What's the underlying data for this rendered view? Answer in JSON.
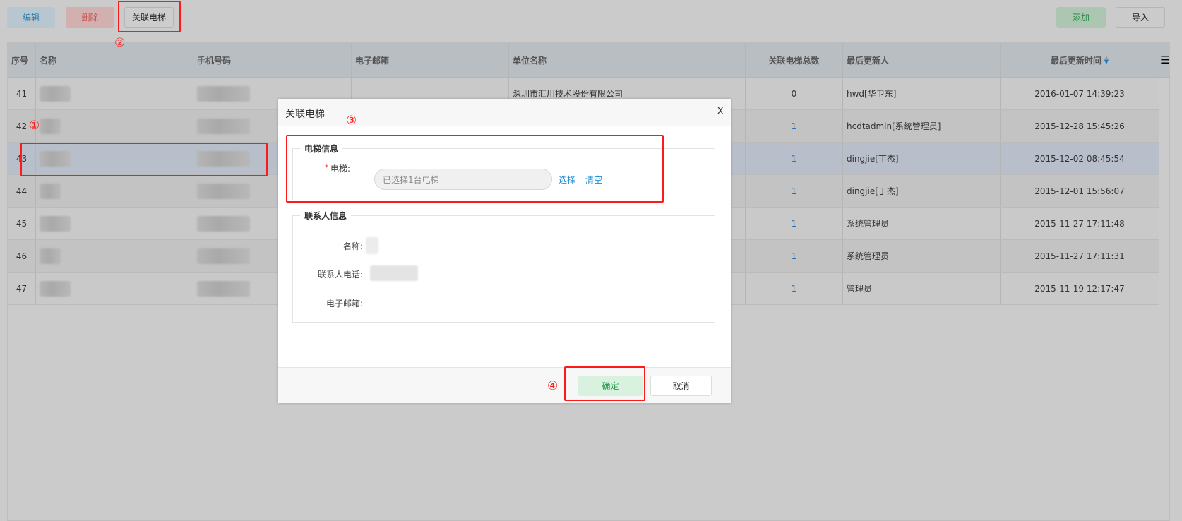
{
  "toolbar": {
    "edit": "编辑",
    "delete": "删除",
    "link_elevator": "关联电梯",
    "add": "添加",
    "import": "导入"
  },
  "annotations": [
    "①",
    "②",
    "③",
    "④"
  ],
  "table": {
    "columns": [
      "序号",
      "名称",
      "手机号码",
      "电子邮箱",
      "单位名称",
      "关联电梯总数",
      "最后更新人",
      "最后更新时间"
    ],
    "sort_icon": "sort-icon",
    "menu_icon": "hamburger-menu-icon",
    "rows": [
      {
        "no": "41",
        "company": "深圳市汇川技术股份有限公司",
        "count": "0",
        "updater": "hwd[华卫东]",
        "time": "2016-01-07 14:39:23"
      },
      {
        "no": "42",
        "company": "",
        "count": "1",
        "updater": "hcdtadmin[系统管理员]",
        "time": "2015-12-28 15:45:26"
      },
      {
        "no": "43",
        "company": "",
        "count": "1",
        "updater": "dingjie[丁杰]",
        "time": "2015-12-02 08:45:54",
        "selected": true
      },
      {
        "no": "44",
        "company": "",
        "count": "1",
        "updater": "dingjie[丁杰]",
        "time": "2015-12-01 15:56:07"
      },
      {
        "no": "45",
        "company": "",
        "count": "1",
        "updater": "系统管理员",
        "time": "2015-11-27 17:11:48"
      },
      {
        "no": "46",
        "company": "",
        "count": "1",
        "updater": "系统管理员",
        "time": "2015-11-27 17:11:31"
      },
      {
        "no": "47",
        "company": "",
        "count": "1",
        "updater": "管理员",
        "time": "2015-11-19 12:17:47"
      }
    ]
  },
  "dialog": {
    "title": "关联电梯",
    "close": "X",
    "elevator_section": "电梯信息",
    "elevator_label": "电梯:",
    "required_mark": "*",
    "elevator_value": "已选择1台电梯",
    "select": "选择",
    "clear": "清空",
    "contact_section": "联系人信息",
    "name_label": "名称:",
    "phone_label": "联系人电话:",
    "email_label": "电子邮箱:",
    "confirm": "确定",
    "cancel": "取消"
  },
  "colors": {
    "accent_blue": "#1a8ad4",
    "annotation_red": "#ff1a1a",
    "confirm_green": "#1e9b48"
  }
}
